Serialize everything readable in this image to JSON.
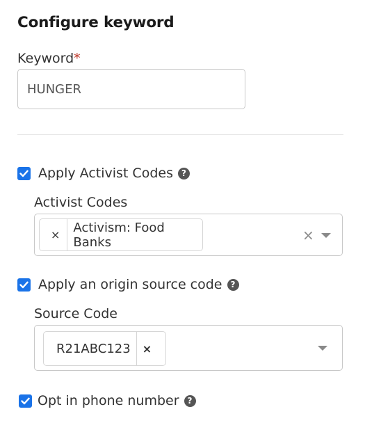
{
  "title": "Configure keyword",
  "keyword": {
    "label": "Keyword",
    "required_mark": "*",
    "value": "HUNGER"
  },
  "activist": {
    "checkbox_label": "Apply Activist Codes",
    "checked": true,
    "field_label": "Activist Codes",
    "tags": [
      "Activism: Food Banks"
    ],
    "clear_icon": "×",
    "remove_icon": "×"
  },
  "source": {
    "checkbox_label": "Apply an origin source code",
    "checked": true,
    "field_label": "Source Code",
    "tags": [
      "R21ABC123"
    ],
    "remove_icon": "×"
  },
  "optin": {
    "checkbox_label": "Opt in phone number",
    "checked": true
  },
  "help_glyph": "?",
  "colors": {
    "checkbox": "#1a73e8",
    "required": "#c0392b"
  }
}
